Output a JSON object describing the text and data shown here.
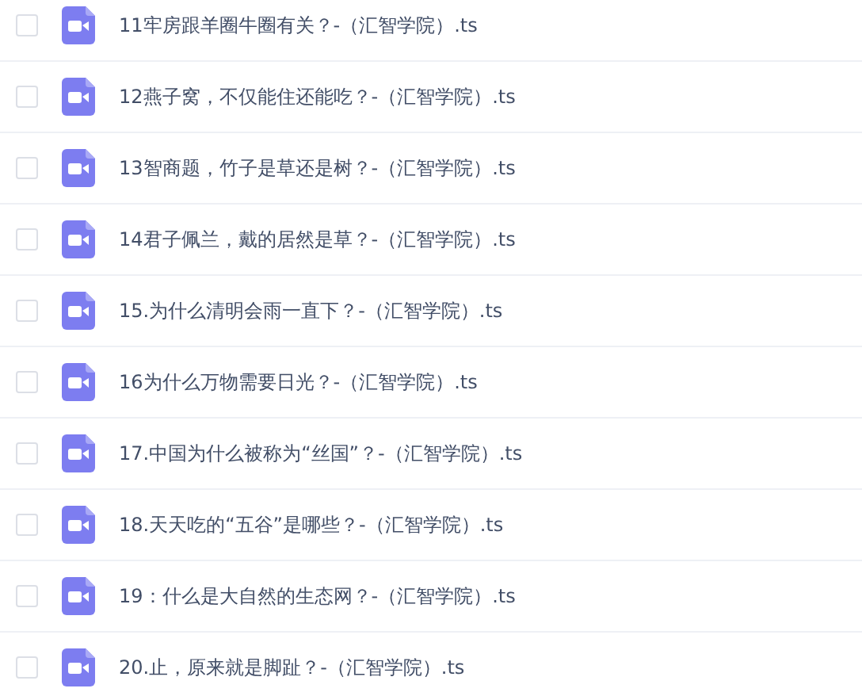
{
  "files": [
    {
      "name": "11牢房跟羊圈牛圈有关？-（汇智学院）.ts",
      "checked": false
    },
    {
      "name": "12燕子窝，不仅能住还能吃？-（汇智学院）.ts",
      "checked": false
    },
    {
      "name": "13智商题，竹子是草还是树？-（汇智学院）.ts",
      "checked": false
    },
    {
      "name": "14君子佩兰，戴的居然是草？-（汇智学院）.ts",
      "checked": false
    },
    {
      "name": "15.为什么清明会雨一直下？-（汇智学院）.ts",
      "checked": false
    },
    {
      "name": "16为什么万物需要日光？-（汇智学院）.ts",
      "checked": false
    },
    {
      "name": "17.中国为什么被称为“丝国”？-（汇智学院）.ts",
      "checked": false
    },
    {
      "name": "18.天天吃的“五谷”是哪些？-（汇智学院）.ts",
      "checked": false
    },
    {
      "name": "19：什么是大自然的生态网？-（汇智学院）.ts",
      "checked": false
    },
    {
      "name": "20.止，原来就是脚趾？-（汇智学院）.ts",
      "checked": false
    }
  ]
}
